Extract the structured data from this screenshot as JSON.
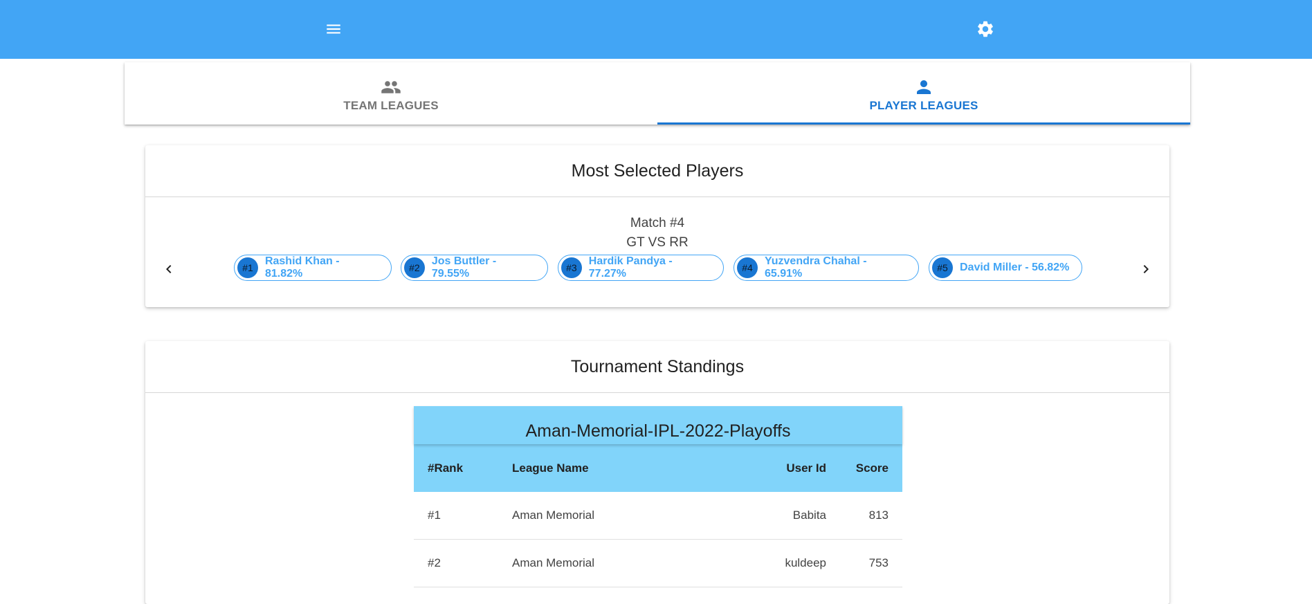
{
  "appbar": {
    "menu_icon": "menu-icon",
    "settings_icon": "gear-icon",
    "color": "#42a5f5"
  },
  "tabs": [
    {
      "label": "TEAM LEAGUES",
      "icon": "group-icon",
      "active": false
    },
    {
      "label": "PLAYER LEAGUES",
      "icon": "person-icon",
      "active": true
    }
  ],
  "most_selected": {
    "title": "Most Selected Players",
    "match_label": "Match #4",
    "teams": "GT VS RR",
    "players": [
      {
        "rank": "#1",
        "text": "Rashid Khan - 81.82%"
      },
      {
        "rank": "#2",
        "text": "Jos Buttler - 79.55%"
      },
      {
        "rank": "#3",
        "text": "Hardik Pandya - 77.27%"
      },
      {
        "rank": "#4",
        "text": "Yuzvendra Chahal - 65.91%"
      },
      {
        "rank": "#5",
        "text": "David Miller - 56.82%"
      }
    ]
  },
  "standings": {
    "title": "Tournament Standings",
    "league": "Aman-Memorial-IPL-2022-Playoffs",
    "columns": [
      "#Rank",
      "League Name",
      "User Id",
      "Score"
    ],
    "rows": [
      [
        "#1",
        "Aman Memorial",
        "Babita",
        "813"
      ],
      [
        "#2",
        "Aman Memorial",
        "kuldeep",
        "753"
      ]
    ]
  },
  "colors": {
    "accent": "#1976d2",
    "chip": "#42a5f5",
    "table_header": "#81d4fa"
  }
}
